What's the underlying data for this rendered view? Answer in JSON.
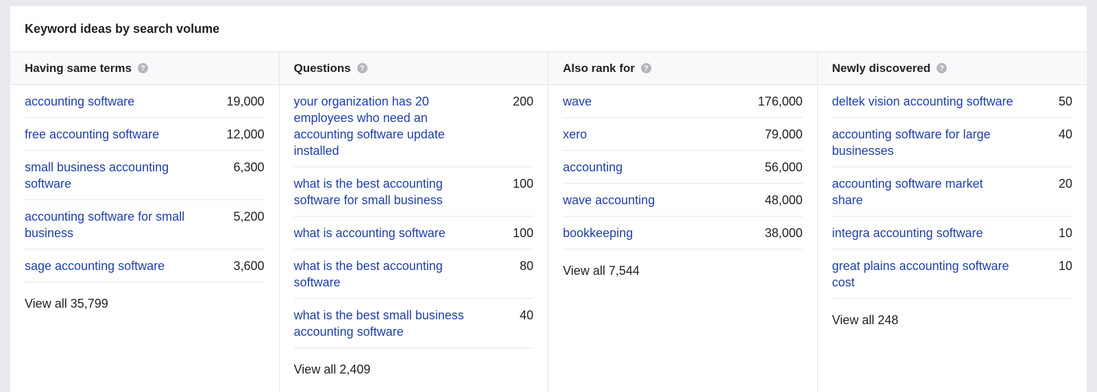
{
  "title": "Keyword ideas by search volume",
  "columns": [
    {
      "heading": "Having same terms",
      "rows": [
        {
          "keyword": "accounting software",
          "volume": "19,000"
        },
        {
          "keyword": "free accounting software",
          "volume": "12,000"
        },
        {
          "keyword": "small business accounting software",
          "volume": "6,300"
        },
        {
          "keyword": "accounting software for small business",
          "volume": "5,200"
        },
        {
          "keyword": "sage accounting software",
          "volume": "3,600"
        }
      ],
      "view_all": "View all 35,799"
    },
    {
      "heading": "Questions",
      "rows": [
        {
          "keyword": "your organization has 20 employees who need an accounting software update installed",
          "volume": "200"
        },
        {
          "keyword": "what is the best accounting software for small business",
          "volume": "100"
        },
        {
          "keyword": "what is accounting software",
          "volume": "100"
        },
        {
          "keyword": "what is the best accounting software",
          "volume": "80"
        },
        {
          "keyword": "what is the best small business accounting software",
          "volume": "40"
        }
      ],
      "view_all": "View all 2,409"
    },
    {
      "heading": "Also rank for",
      "rows": [
        {
          "keyword": "wave",
          "volume": "176,000"
        },
        {
          "keyword": "xero",
          "volume": "79,000"
        },
        {
          "keyword": "accounting",
          "volume": "56,000"
        },
        {
          "keyword": "wave accounting",
          "volume": "48,000"
        },
        {
          "keyword": "bookkeeping",
          "volume": "38,000"
        }
      ],
      "view_all": "View all 7,544"
    },
    {
      "heading": "Newly discovered",
      "rows": [
        {
          "keyword": "deltek vision accounting software",
          "volume": "50"
        },
        {
          "keyword": "accounting software for large businesses",
          "volume": "40"
        },
        {
          "keyword": "accounting software market share",
          "volume": "20"
        },
        {
          "keyword": "integra accounting software",
          "volume": "10"
        },
        {
          "keyword": "great plains accounting software cost",
          "volume": "10"
        }
      ],
      "view_all": "View all 248"
    }
  ],
  "help_icon_glyph": "?",
  "colors": {
    "link": "#1f3fa6",
    "text": "#222222",
    "divider": "#e4e6ea",
    "header_bg": "#f8f9fb",
    "page_bg": "#e9eaee"
  }
}
